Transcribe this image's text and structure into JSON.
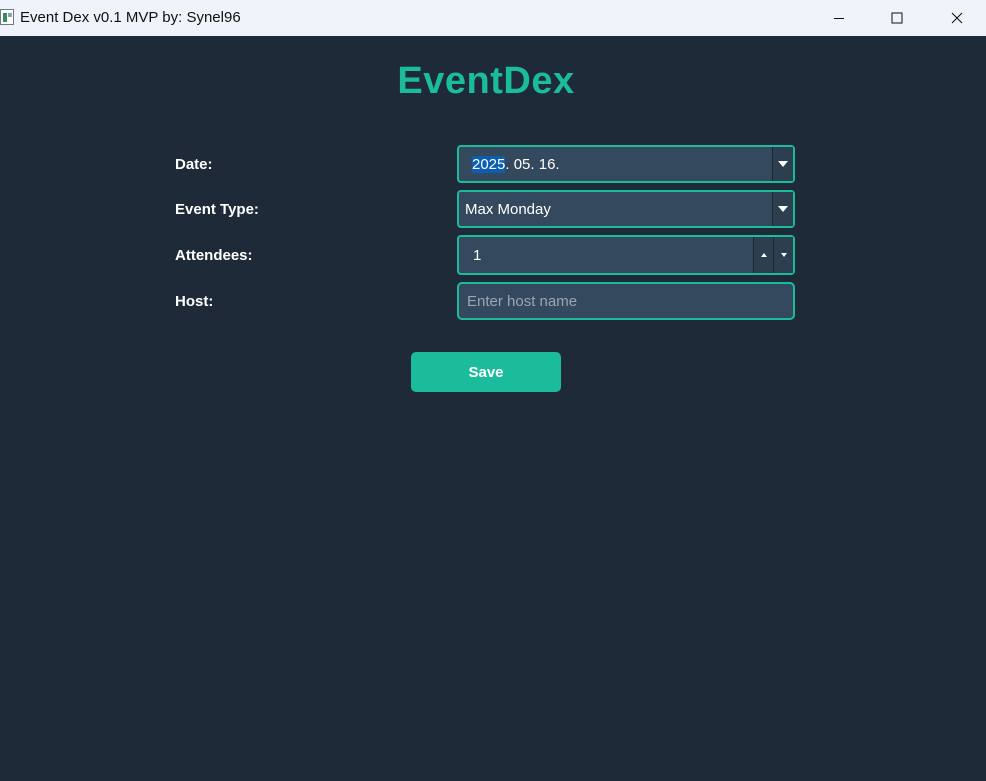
{
  "window": {
    "title": "Event Dex v0.1 MVP by: Synel96",
    "icon": "app-window-icon",
    "controls": [
      "minimize-icon",
      "maximize-icon",
      "close-icon"
    ]
  },
  "app": {
    "title": "EventDex"
  },
  "form": {
    "date": {
      "label": "Date:",
      "value_year": "2025",
      "value_rest": ". 05. 16."
    },
    "event_type": {
      "label": "Event Type:",
      "value": "Max Monday"
    },
    "attendees": {
      "label": "Attendees:",
      "value": "1"
    },
    "host": {
      "label": "Host:",
      "placeholder": "Enter host name",
      "value": ""
    },
    "save_label": "Save"
  },
  "colors": {
    "background": "#1f2a38",
    "accent": "#1abc9c",
    "field_bg": "#34495e",
    "selection": "#0a5fb4"
  }
}
